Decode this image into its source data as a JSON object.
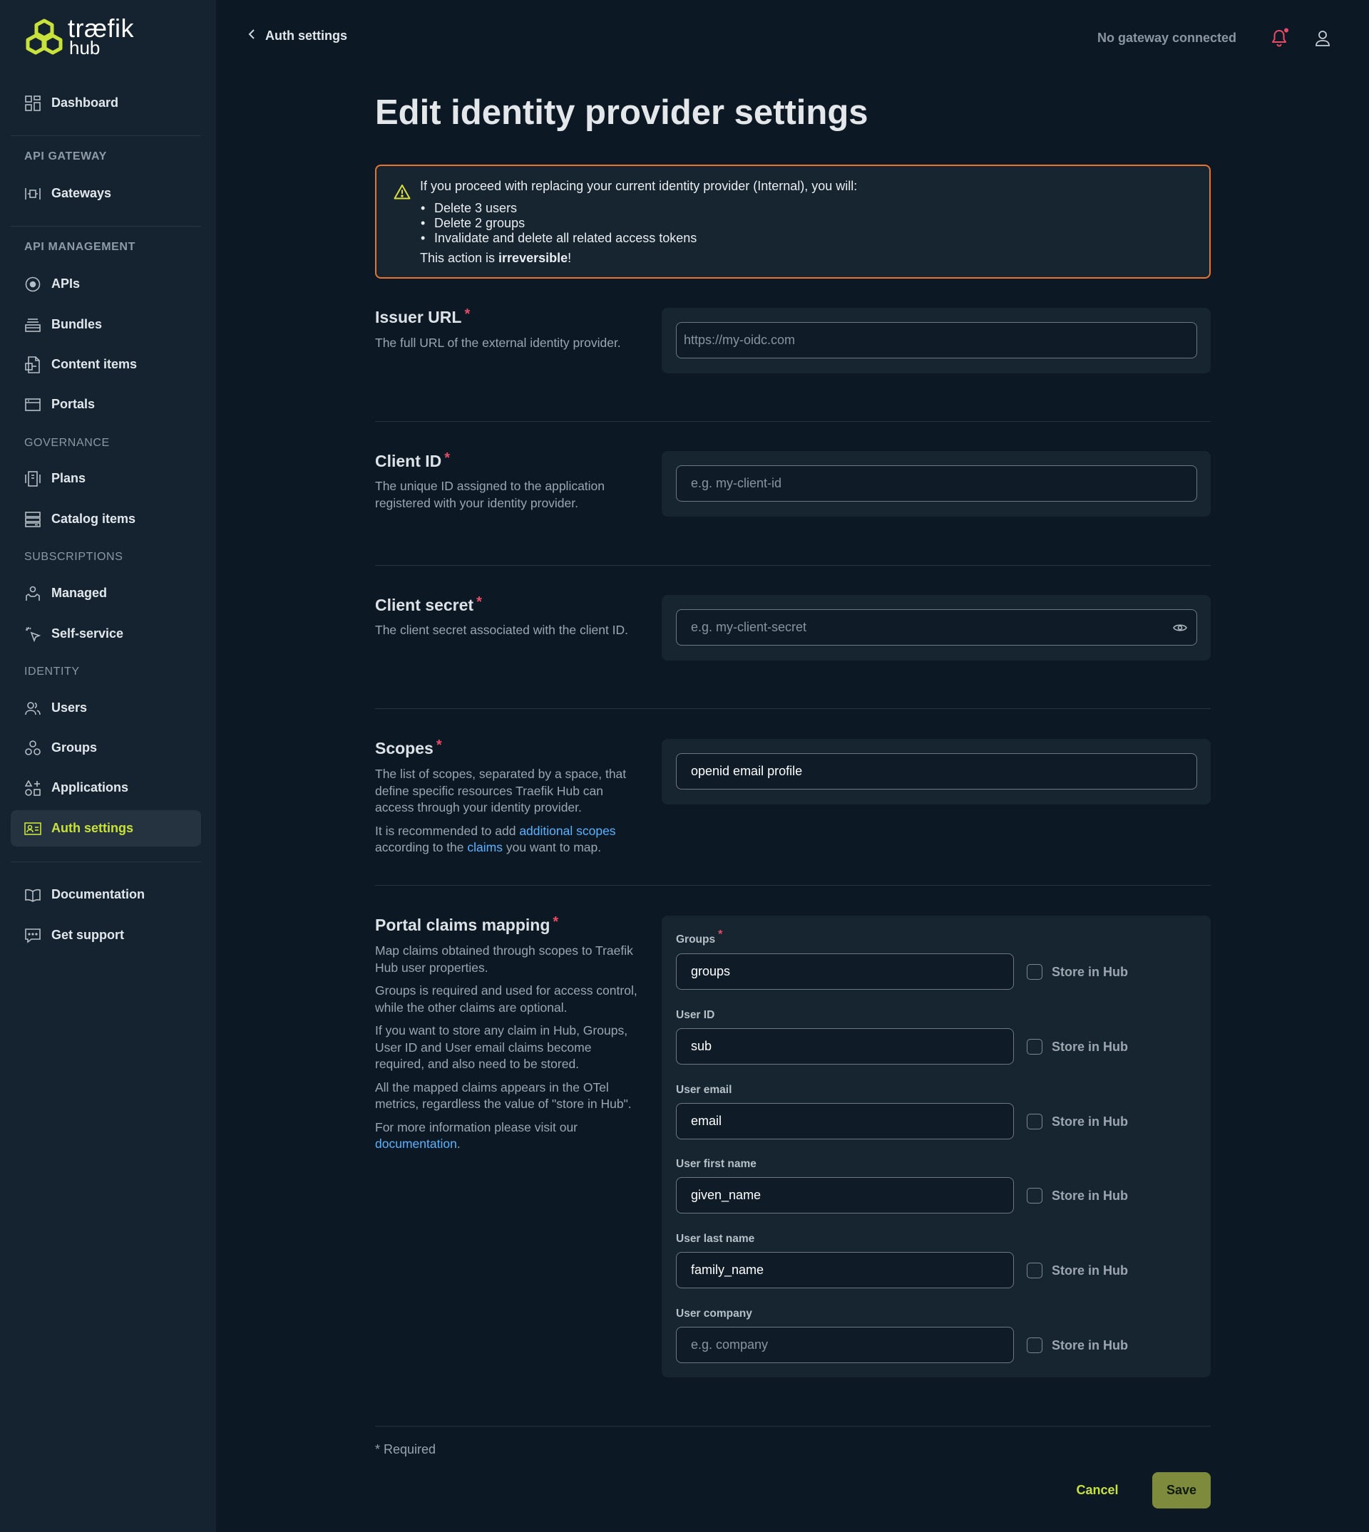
{
  "logo": {
    "brand": "træfik",
    "product": "hub"
  },
  "sidebar": {
    "dashboard": "Dashboard",
    "sections": {
      "api_gateway": "API GATEWAY",
      "api_management": "API MANAGEMENT",
      "governance": "GOVERNANCE",
      "subscriptions": "SUBSCRIPTIONS",
      "identity": "IDENTITY"
    },
    "items": {
      "gateways": "Gateways",
      "apis": "APIs",
      "bundles": "Bundles",
      "content_items": "Content items",
      "portals": "Portals",
      "plans": "Plans",
      "catalog_items": "Catalog items",
      "managed": "Managed",
      "self_service": "Self-service",
      "users": "Users",
      "groups": "Groups",
      "applications": "Applications",
      "auth_settings": "Auth settings",
      "documentation": "Documentation",
      "get_support": "Get support"
    },
    "active": "auth_settings"
  },
  "topbar": {
    "back_label": "Auth settings",
    "gateway_status": "No gateway connected"
  },
  "page": {
    "title": "Edit identity provider settings"
  },
  "warning": {
    "main": "If you proceed with replacing your current identity provider (Internal), you will:",
    "items": [
      "Delete 3 users",
      "Delete 2 groups",
      "Invalidate and delete all related access tokens"
    ],
    "foot_prefix": "This action is ",
    "foot_bold": "irreversible",
    "foot_suffix": "!"
  },
  "form": {
    "issuer_url": {
      "label": "Issuer URL",
      "required": "*",
      "description": "The full URL of the external identity provider.",
      "placeholder": "https://my-oidc.com",
      "value": ""
    },
    "client_id": {
      "label": "Client ID",
      "required": "*",
      "description": "The unique ID assigned to the application registered with your identity provider.",
      "placeholder": "e.g. my-client-id",
      "value": ""
    },
    "client_secret": {
      "label": "Client secret",
      "required": "*",
      "description": "The client secret associated with the client ID.",
      "placeholder": "e.g. my-client-secret",
      "value": ""
    },
    "scopes": {
      "label": "Scopes",
      "required": "*",
      "description": "The list of scopes, separated by a space, that define specific resources Traefik Hub can access through your identity provider.",
      "note_prefix": "It is recommended to add ",
      "note_link1": "additional scopes",
      "note_middle": " according to the ",
      "note_link2": "claims",
      "note_suffix": " you want to map.",
      "value": "openid email profile"
    },
    "claims": {
      "label": "Portal claims mapping",
      "required": "*",
      "desc1": "Map claims obtained through scopes to Traefik Hub user properties.",
      "desc2": "Groups is required and used for access control, while the other claims are optional.",
      "desc3": "If you want to store any claim in Hub, Groups, User ID and User email claims become required, and also need to be stored.",
      "desc4": "All the mapped claims appears in the OTel metrics, regardless the value of \"store in Hub\".",
      "desc5_prefix": "For more information please visit our ",
      "desc5_link": "documentation",
      "desc5_suffix": ".",
      "store_label": "Store in Hub",
      "rows": [
        {
          "label": "Groups",
          "required": "*",
          "value": "groups",
          "placeholder": "",
          "stored": false
        },
        {
          "label": "User ID",
          "required": "",
          "value": "sub",
          "placeholder": "",
          "stored": false
        },
        {
          "label": "User email",
          "required": "",
          "value": "email",
          "placeholder": "",
          "stored": false
        },
        {
          "label": "User first name",
          "required": "",
          "value": "given_name",
          "placeholder": "",
          "stored": false
        },
        {
          "label": "User last name",
          "required": "",
          "value": "family_name",
          "placeholder": "",
          "stored": false
        },
        {
          "label": "User company",
          "required": "",
          "value": "",
          "placeholder": "e.g. company",
          "stored": false
        }
      ]
    },
    "required_note": "* Required",
    "cancel": "Cancel",
    "save": "Save"
  },
  "colors": {
    "accent": "#c9e13b",
    "warning_border": "#e8742f",
    "required": "#e94c66",
    "link": "#5ab2ff",
    "save_bg": "#7f8b3c"
  }
}
